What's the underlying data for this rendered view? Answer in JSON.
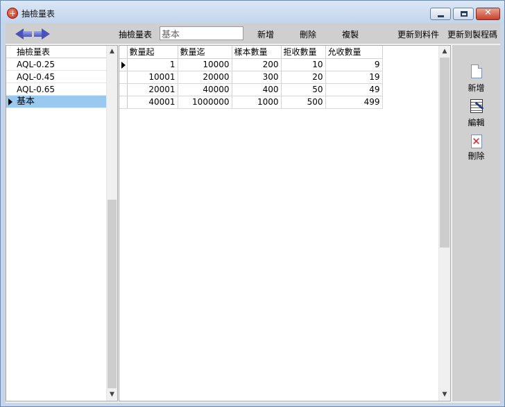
{
  "window": {
    "title": "抽檢量表"
  },
  "toolbar": {
    "table_label": "抽檢量表",
    "table_input_value": "基本",
    "add_label": "新增",
    "delete_label": "刪除",
    "copy_label": "複製",
    "update_material_label": "更新到料件",
    "update_process_label": "更新到製程碼"
  },
  "left_list": {
    "header": "抽檢量表",
    "items": [
      {
        "label": "AQL-0.25"
      },
      {
        "label": "AQL-0.45"
      },
      {
        "label": "AQL-0.65"
      },
      {
        "label": "基本"
      }
    ],
    "selected_index": 3
  },
  "grid": {
    "columns": [
      "數量起",
      "數量迄",
      "樣本數量",
      "拒收數量",
      "允收數量"
    ],
    "rows": [
      [
        "1",
        "10000",
        "200",
        "10",
        "9"
      ],
      [
        "10001",
        "20000",
        "300",
        "20",
        "19"
      ],
      [
        "20001",
        "40000",
        "400",
        "50",
        "49"
      ],
      [
        "40001",
        "1000000",
        "1000",
        "500",
        "499"
      ]
    ],
    "current_row": 0
  },
  "side_panel": {
    "add_label": "新增",
    "edit_label": "編輯",
    "delete_label": "刪除"
  },
  "colors": {
    "title_bar": "#c5d5ea",
    "selection": "#99c9ef",
    "toolbar": "#cfcfcf",
    "nav_arrow": "#4a52b6"
  },
  "icons": {
    "app": "app-globe-icon",
    "nav_back": "arrow-left-icon",
    "nav_forward": "arrow-right-icon",
    "add": "new-document-icon",
    "edit": "edit-document-icon",
    "delete": "delete-document-icon"
  }
}
